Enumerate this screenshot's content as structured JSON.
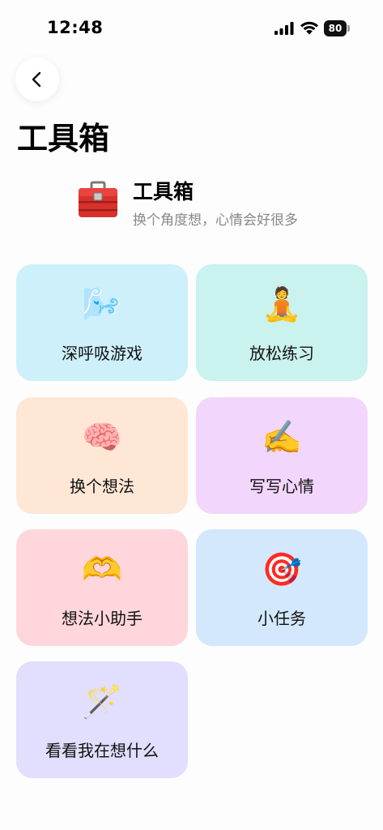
{
  "status_bar": {
    "time": "12:48",
    "battery": "80"
  },
  "page": {
    "title": "工具箱"
  },
  "header": {
    "title": "工具箱",
    "subtitle": "换个角度想，心情会好很多",
    "icon": "toolbox-icon"
  },
  "tools": [
    {
      "label": "深呼吸游戏",
      "icon": "blowing-face-icon",
      "emoji": "🌬️",
      "color": "#cdf0fa"
    },
    {
      "label": "放松练习",
      "icon": "meditation-icon",
      "emoji": "🧘",
      "color": "#caf2ee"
    },
    {
      "label": "换个想法",
      "icon": "brain-icon",
      "emoji": "🧠",
      "color": "#ffe7d6"
    },
    {
      "label": "写写心情",
      "icon": "writing-hand-icon",
      "emoji": "✍️",
      "color": "#f3d6fb"
    },
    {
      "label": "想法小助手",
      "icon": "heart-hands-icon",
      "emoji": "🫶",
      "color": "#ffd6dc"
    },
    {
      "label": "小任务",
      "icon": "target-icon",
      "emoji": "🎯",
      "color": "#d3e8fd"
    },
    {
      "label": "看看我在想什么",
      "icon": "magic-wand-icon",
      "emoji": "🪄",
      "color": "#e1defe"
    }
  ]
}
